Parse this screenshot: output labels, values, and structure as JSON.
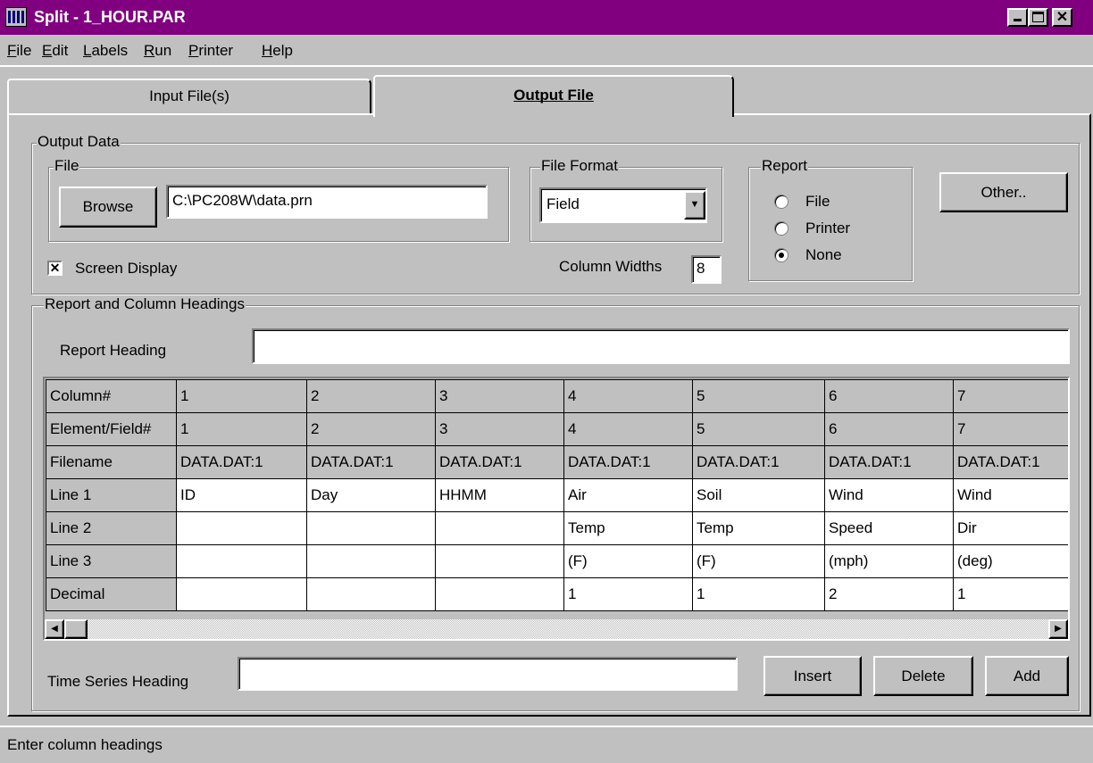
{
  "window": {
    "title": "Split - 1_HOUR.PAR"
  },
  "menu": [
    "File",
    "Edit",
    "Labels",
    "Run",
    "Printer",
    "Help"
  ],
  "tabs": {
    "input": "Input File(s)",
    "output": "Output File"
  },
  "output_data": {
    "group_label": "Output Data",
    "file_group": "File",
    "browse": "Browse",
    "file_path": "C:\\PC208W\\data.prn",
    "format_group": "File Format",
    "format_value": "Field",
    "report_group": "Report",
    "report_options": [
      "File",
      "Printer",
      "None"
    ],
    "report_selected": "None",
    "other": "Other..",
    "screen_display": "Screen Display",
    "screen_display_checked": true,
    "column_widths_label": "Column Widths",
    "column_widths_value": "8"
  },
  "headings": {
    "group_label": "Report and Column Headings",
    "report_heading_label": "Report Heading",
    "report_heading_value": "",
    "time_series_label": "Time Series Heading",
    "time_series_value": "",
    "insert": "Insert",
    "delete": "Delete",
    "add": "Add"
  },
  "grid": {
    "row_headers": [
      "Column#",
      "Element/Field#",
      "Filename",
      "Line 1",
      "Line 2",
      "Line 3",
      "Decimal"
    ],
    "columns": [
      [
        "1",
        "1",
        "DATA.DAT:1",
        "ID",
        "",
        "",
        ""
      ],
      [
        "2",
        "2",
        "DATA.DAT:1",
        "Day",
        "",
        "",
        ""
      ],
      [
        "3",
        "3",
        "DATA.DAT:1",
        "HHMM",
        "",
        "",
        ""
      ],
      [
        "4",
        "4",
        "DATA.DAT:1",
        "Air",
        "Temp",
        "(F)",
        "1"
      ],
      [
        "5",
        "5",
        "DATA.DAT:1",
        "Soil",
        "Temp",
        "(F)",
        "1"
      ],
      [
        "6",
        "6",
        "DATA.DAT:1",
        "Wind",
        "Speed",
        "(mph)",
        "2"
      ],
      [
        "7",
        "7",
        "DATA.DAT:1",
        "Wind",
        "Dir",
        "(deg)",
        "1"
      ]
    ]
  },
  "status": "Enter column headings"
}
